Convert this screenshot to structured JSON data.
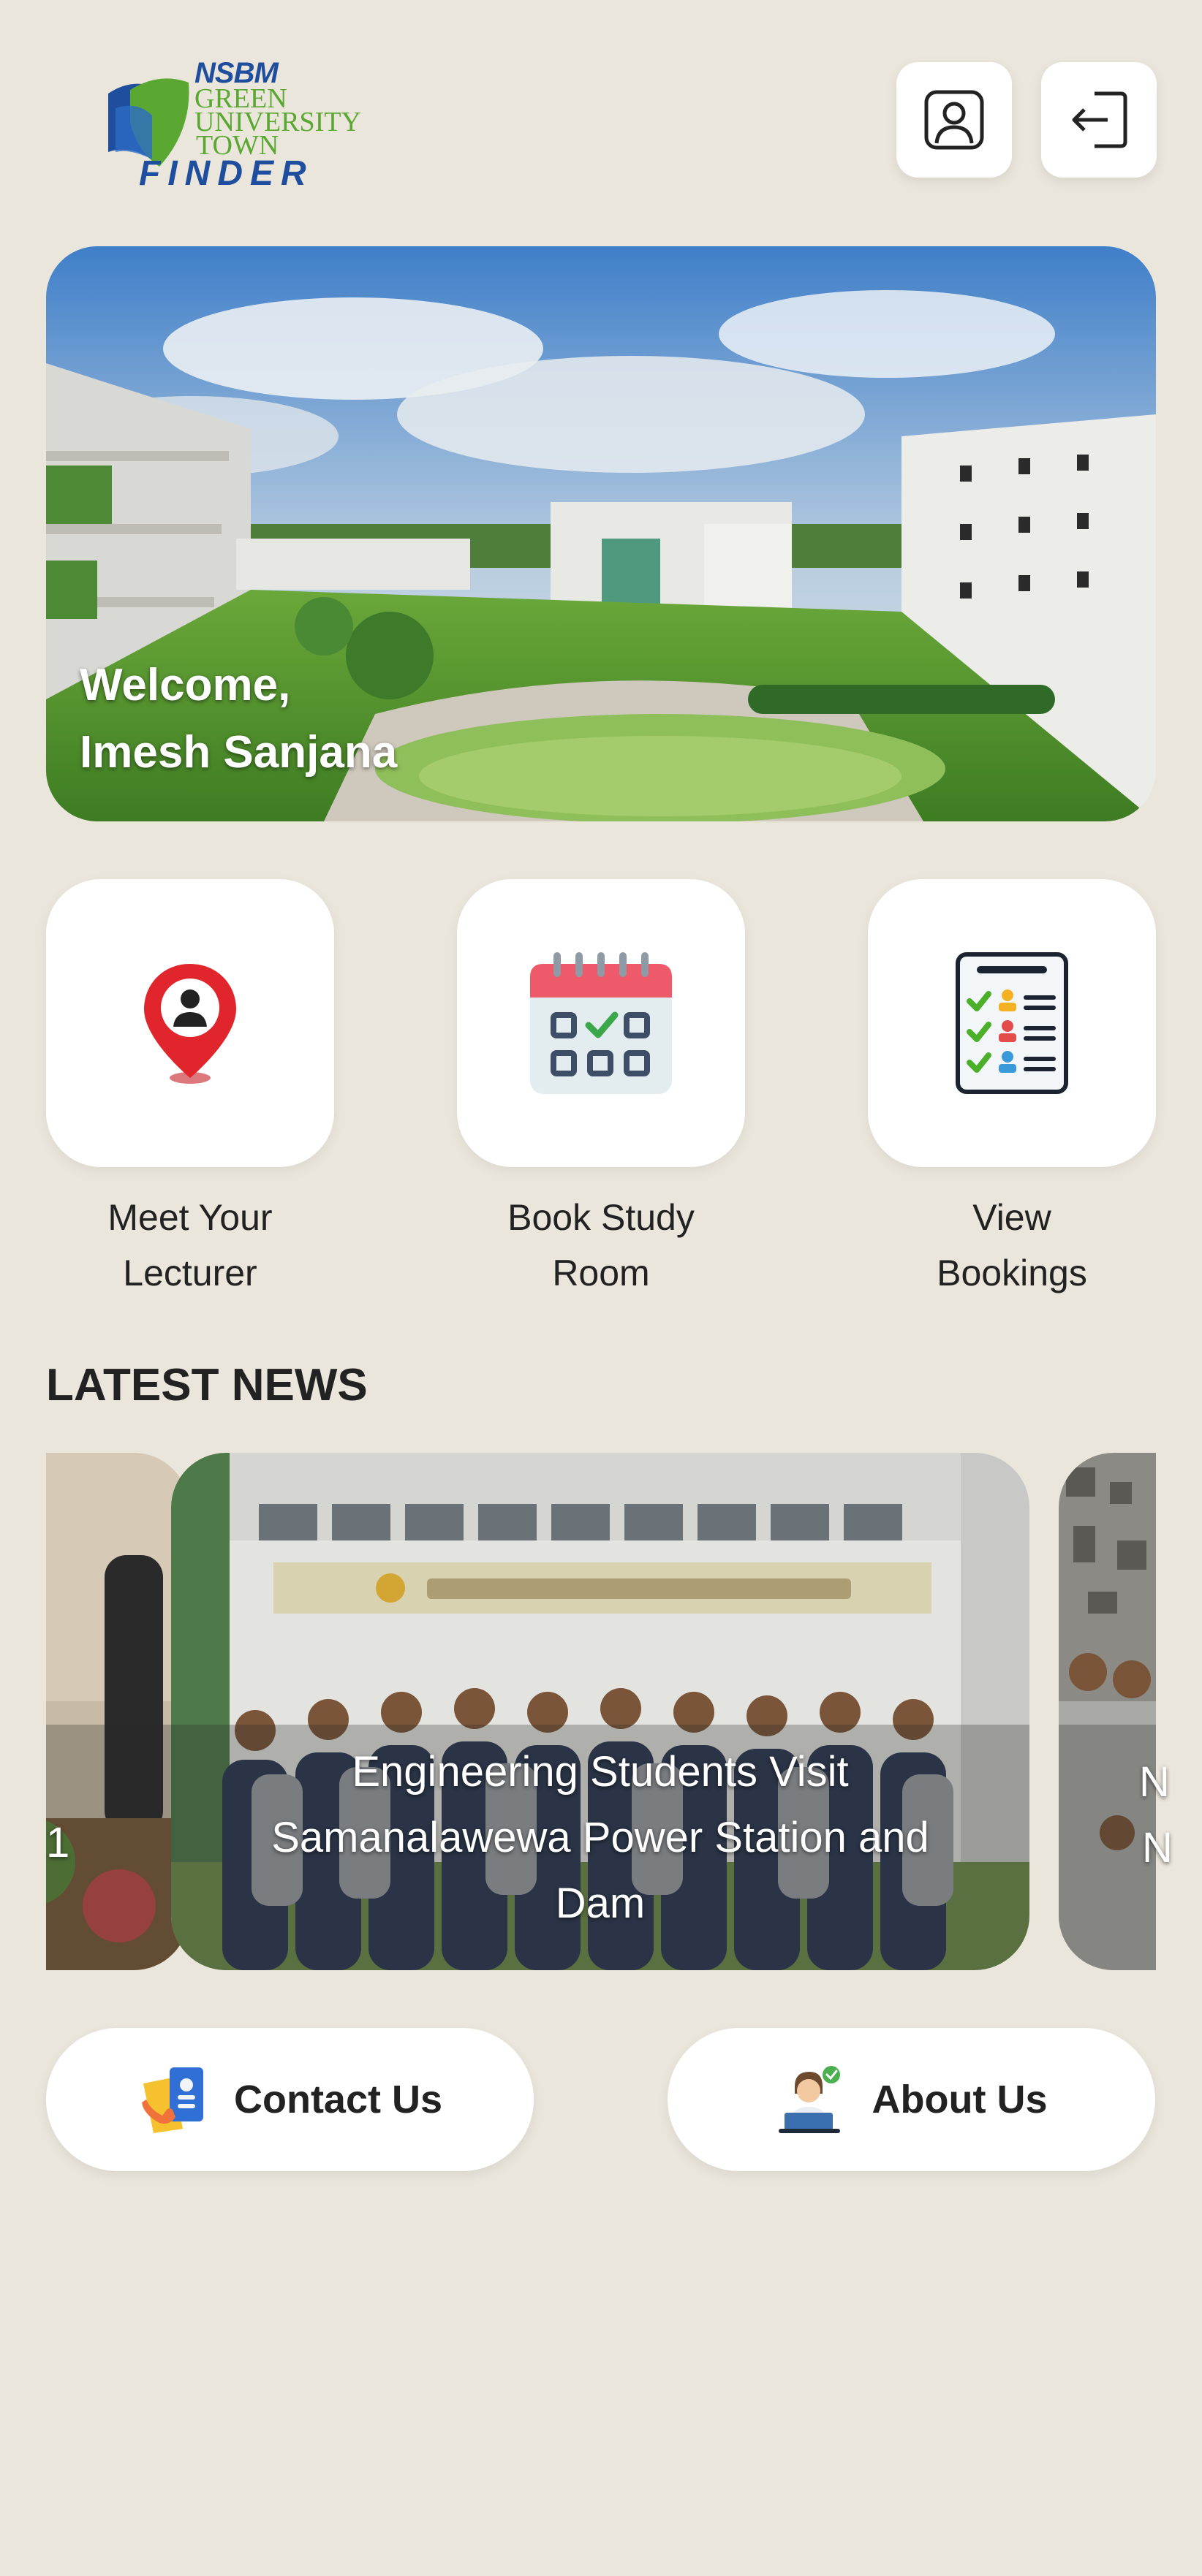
{
  "header": {
    "logo": {
      "brand": "NSBM",
      "line1": "GREEN",
      "line2": "UNIVERSITY",
      "line3": "TOWN",
      "product": "FINDER"
    },
    "profile_icon": "profile-icon",
    "logout_icon": "logout-icon"
  },
  "hero": {
    "greeting": "Welcome,",
    "user_name": "Imesh Sanjana"
  },
  "quick_actions": [
    {
      "label_line1": "Meet Your",
      "label_line2": "Lecturer",
      "icon": "location-pin-icon"
    },
    {
      "label_line1": "Book Study",
      "label_line2": "Room",
      "icon": "calendar-icon"
    },
    {
      "label_line1": "View",
      "label_line2": "Bookings",
      "icon": "checklist-icon"
    }
  ],
  "news": {
    "title": "LATEST NEWS",
    "current_caption_line1": "Engineering Students Visit",
    "current_caption_line2": "Samanalawewa Power Station and",
    "current_caption_line3": "Dam",
    "prev_caption_tail": "1",
    "next_caption_head1": "N",
    "next_caption_head2": "N"
  },
  "footer_buttons": {
    "contact_label": "Contact Us",
    "about_label": "About Us"
  },
  "colors": {
    "background": "#ebe6dc",
    "brand_blue": "#1f4e9e",
    "brand_green": "#5aa832",
    "pin_red": "#e0262c"
  }
}
